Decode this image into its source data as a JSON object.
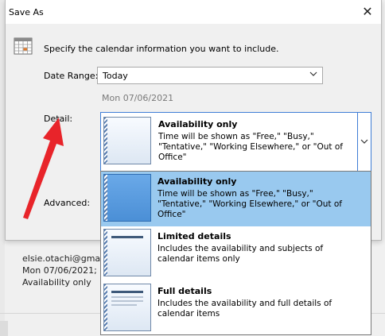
{
  "dialog": {
    "title": "Save As",
    "intro": "Specify the calendar information you want to include.",
    "date_range_label": "Date Range:",
    "date_range_value": "Today",
    "date_sub": "Mon 07/06/2021",
    "detail_label": "Detail:",
    "advanced_label": "Advanced:"
  },
  "detail_combo": {
    "title": "Availability only",
    "description": "Time will be shown as \"Free,\" \"Busy,\" \"Tentative,\" \"Working Elsewhere,\" or \"Out of Office\""
  },
  "detail_options": [
    {
      "title": "Availability only",
      "description": "Time will be shown as \"Free,\" \"Busy,\" \"Tentative,\" \"Working Elsewhere,\" or \"Out of Office\"",
      "selected": true
    },
    {
      "title": "Limited details",
      "description": "Includes the availability and subjects of calendar items only",
      "selected": false
    },
    {
      "title": "Full details",
      "description": "Includes the availability and full details of calendar items",
      "selected": false
    }
  ],
  "background_info": {
    "email": "elsie.otachi@gma",
    "date": "Mon 07/06/2021;",
    "availability": "Availability only"
  },
  "colors": {
    "selected_highlight": "#99c9ef",
    "focus_border": "#3f7dd6",
    "arrow": "#e8242a"
  },
  "icons": {
    "calendar": "calendar-icon",
    "close": "close-icon",
    "dropdown": "chevron-down-icon",
    "annotation": "red-arrow"
  }
}
